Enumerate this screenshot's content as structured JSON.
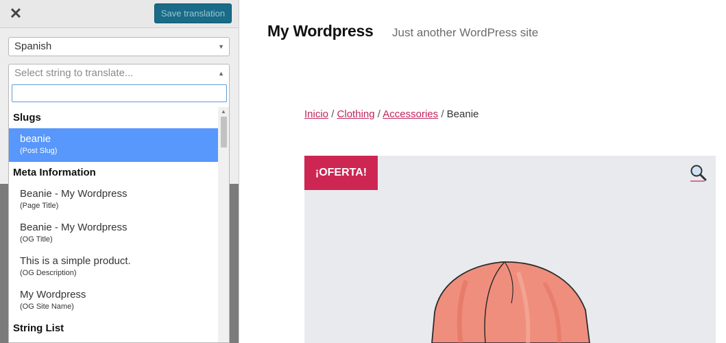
{
  "panel": {
    "close_icon": "close-icon",
    "save_label": "Save translation",
    "language_selected": "Spanish",
    "string_placeholder": "Select string to translate...",
    "groups": [
      {
        "label": "Slugs"
      },
      {
        "label": "Meta Information"
      },
      {
        "label": "String List"
      }
    ],
    "options": [
      {
        "text": "beanie",
        "sub": "(Post Slug)"
      },
      {
        "text": "Beanie - My Wordpress",
        "sub": "(Page Title)"
      },
      {
        "text": "Beanie - My Wordpress",
        "sub": "(OG Title)"
      },
      {
        "text": "This is a simple product.",
        "sub": "(OG Description)"
      },
      {
        "text": "My Wordpress",
        "sub": "(OG Site Name)"
      }
    ]
  },
  "site": {
    "title": "My Wordpress",
    "tagline": "Just another WordPress site",
    "breadcrumb": [
      {
        "label": "Inicio"
      },
      {
        "label": "Clothing"
      },
      {
        "label": "Accessories"
      },
      {
        "label": "Beanie"
      }
    ],
    "breadcrumb_sep": "/",
    "sale_badge": "¡OFERTA!"
  },
  "colors": {
    "accent": "#cd2653",
    "selected": "#5897fb",
    "save_button": "#196b88"
  }
}
